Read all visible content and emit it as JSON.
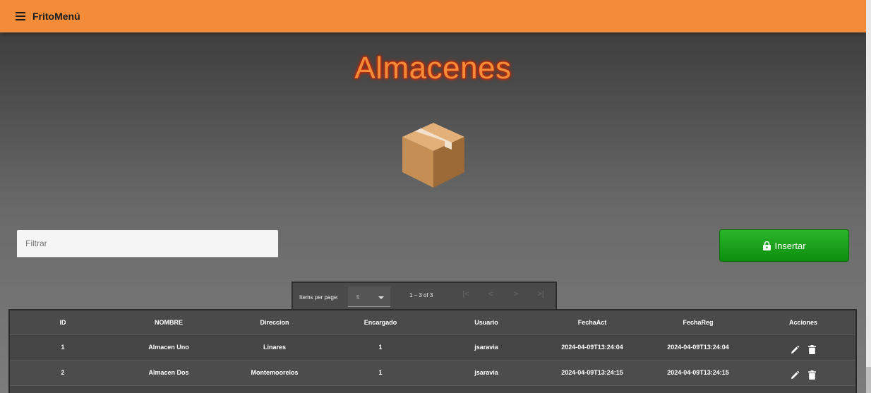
{
  "toolbar": {
    "title": "FritoMenú"
  },
  "page": {
    "title": "Almacenes",
    "icon": "package-box-icon"
  },
  "filter": {
    "placeholder": "Filtrar",
    "value": ""
  },
  "insert_button": {
    "label": "Insertar",
    "icon": "lock-icon",
    "color": "#1aa11a"
  },
  "paginator": {
    "items_per_page_label": "Items per page:",
    "page_size": "5",
    "range": "1 – 3 of 3",
    "nav": {
      "first": "|<",
      "prev": "<",
      "next": ">",
      "last": ">|"
    }
  },
  "table": {
    "headers": {
      "id": "ID",
      "nombre": "NOMBRE",
      "direccion": "Direccion",
      "encargado": "Encargado",
      "usuario": "Usuario",
      "fecha_act": "FechaAct",
      "fecha_reg": "FechaReg",
      "acciones": "Acciones"
    },
    "rows": [
      {
        "id": "1",
        "nombre": "Almacen Uno",
        "direccion": "Linares",
        "encargado": "1",
        "usuario": "jsaravia",
        "fecha_act": "2024-04-09T13:24:04",
        "fecha_reg": "2024-04-09T13:24:04"
      },
      {
        "id": "2",
        "nombre": "Almacen Dos",
        "direccion": "Montemoorelos",
        "encargado": "1",
        "usuario": "jsaravia",
        "fecha_act": "2024-04-09T13:24:15",
        "fecha_reg": "2024-04-09T13:24:15"
      }
    ],
    "action_icons": [
      "edit-icon",
      "delete-icon"
    ]
  },
  "colors": {
    "toolbar": "#f28c38",
    "title": "#f28c38",
    "title_glow": "#d62a00",
    "insert": "#1aa11a"
  }
}
